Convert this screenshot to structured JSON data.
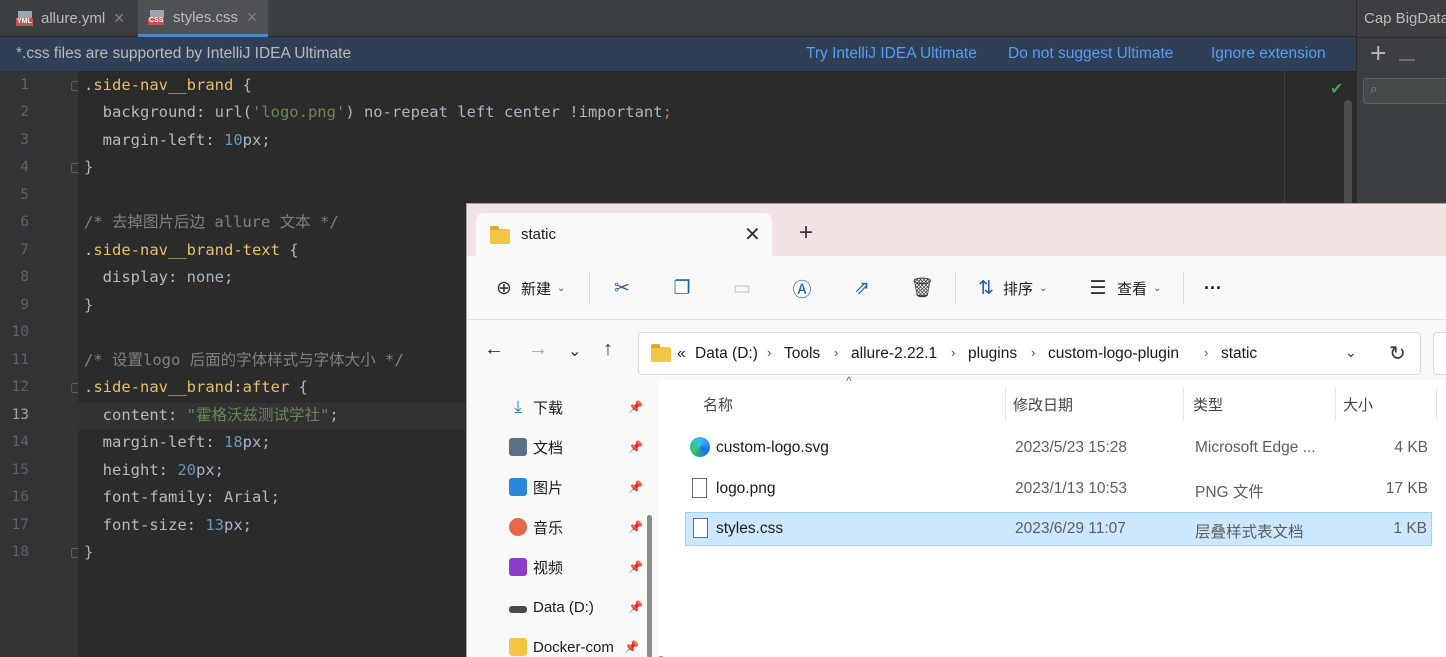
{
  "ide": {
    "tabs": [
      {
        "label": "allure.yml",
        "badge": "YML"
      },
      {
        "label": "styles.css",
        "badge": "CSS",
        "active": true
      }
    ],
    "banner": {
      "message": "*.css files are supported by IntelliJ IDEA Ultimate",
      "links": [
        "Try IntelliJ IDEA Ultimate",
        "Do not suggest Ultimate",
        "Ignore extension"
      ]
    },
    "current_line": 13,
    "side_panel_title": "Cap BigData",
    "lines": [
      {
        "n": "1"
      },
      {
        "n": "2"
      },
      {
        "n": "3"
      },
      {
        "n": "4"
      },
      {
        "n": "5"
      },
      {
        "n": "6"
      },
      {
        "n": "7"
      },
      {
        "n": "8"
      },
      {
        "n": "9"
      },
      {
        "n": "10"
      },
      {
        "n": "11"
      },
      {
        "n": "12"
      },
      {
        "n": "13"
      },
      {
        "n": "14"
      },
      {
        "n": "15"
      },
      {
        "n": "16"
      },
      {
        "n": "17"
      },
      {
        "n": "18"
      }
    ],
    "code": {
      "l1_sel": ".side-nav__brand",
      "l1_brace": " {",
      "l2_prop": "  background: ",
      "l2_fn": "url(",
      "l2_str": "'logo.png'",
      "l2_rest": ") no-repeat left center ",
      "l2_imp": "!important",
      "l2_end": ";",
      "l3_prop": "  margin-left: ",
      "l3_num": "10",
      "l3_unit": "px;",
      "l4": "}",
      "l6_cmt": "/* 去掉图片后边 allure 文本 */",
      "l7_sel": ".side-nav__brand-text",
      "l7_brace": " {",
      "l8_prop": "  display: ",
      "l8_val": "none;",
      "l9": "}",
      "l11_cmt": "/* 设置logo 后面的字体样式与字体大小 */",
      "l12_sel": ".side-nav__brand:after",
      "l12_brace": " {",
      "l13_prop": "  content: ",
      "l13_str": "\"霍格沃兹测试学社\"",
      "l13_end": ";",
      "l14_prop": "  margin-left: ",
      "l14_num": "18",
      "l14_unit": "px;",
      "l15_prop": "  height: ",
      "l15_num": "20",
      "l15_unit": "px;",
      "l16_prop": "  font-family: ",
      "l16_val": "Arial;",
      "l17_prop": "  font-size: ",
      "l17_num": "13",
      "l17_unit": "px;",
      "l18": "}"
    }
  },
  "explorer": {
    "tab_title": "static",
    "toolbar": {
      "new_label": "新建",
      "sort_label": "排序",
      "view_label": "查看",
      "more_label": "···"
    },
    "breadcrumb": {
      "overflow": "«",
      "parts": [
        "Data (D:)",
        "Tools",
        "allure-2.22.1",
        "plugins",
        "custom-logo-plugin",
        "static"
      ]
    },
    "sidebar": [
      {
        "label": "下载",
        "color": "#1f7fd1"
      },
      {
        "label": "文档",
        "color": "#5b6f86"
      },
      {
        "label": "图片",
        "color": "#2b88d8"
      },
      {
        "label": "音乐",
        "color": "#e8674a"
      },
      {
        "label": "视频",
        "color": "#8b3fc9"
      },
      {
        "label": "Data (D:)",
        "color": "#4a4a4a"
      },
      {
        "label": "Docker-com",
        "color": "#f4c542"
      }
    ],
    "columns": {
      "name": "名称",
      "modified": "修改日期",
      "type": "类型",
      "size": "大小"
    },
    "files": [
      {
        "name": "custom-logo.svg",
        "modified": "2023/5/23 15:28",
        "type": "Microsoft Edge ...",
        "size": "4 KB",
        "icon": "edge-icon"
      },
      {
        "name": "logo.png",
        "modified": "2023/1/13 10:53",
        "type": "PNG 文件",
        "size": "17 KB",
        "icon": "image-file-icon"
      },
      {
        "name": "styles.css",
        "modified": "2023/6/29 11:07",
        "type": "层叠样式表文档",
        "size": "1 KB",
        "icon": "css-file-icon",
        "selected": true
      }
    ]
  }
}
